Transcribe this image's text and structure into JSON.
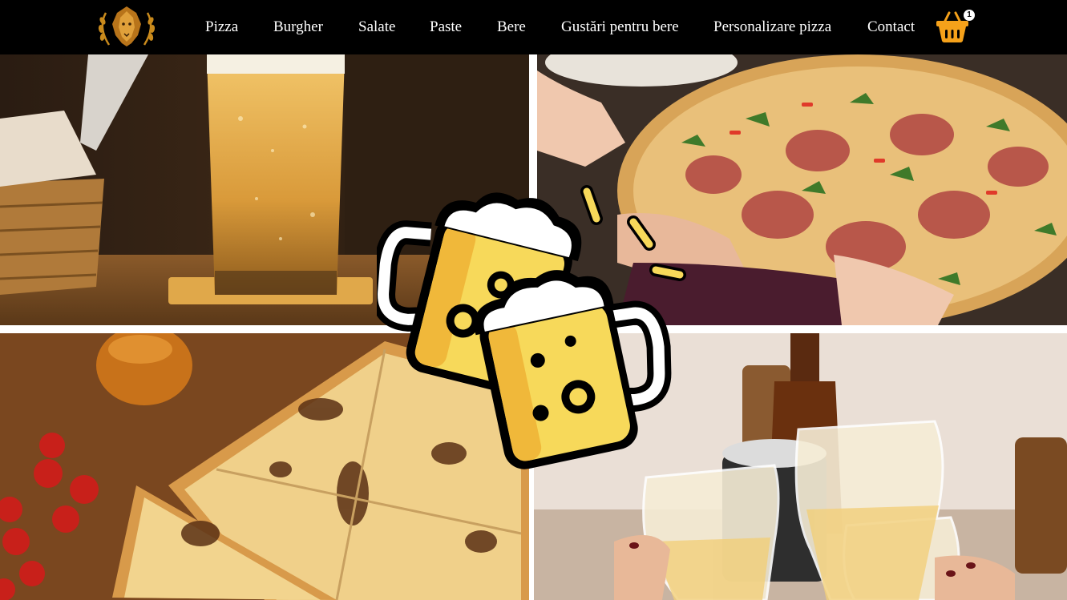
{
  "nav": {
    "logo_icon": "lion-head-laurel-logo",
    "items": [
      {
        "label": "Pizza"
      },
      {
        "label": "Burgher"
      },
      {
        "label": "Salate"
      },
      {
        "label": "Paste"
      },
      {
        "label": "Bere"
      },
      {
        "label": "Gustări pentru bere"
      },
      {
        "label": "Personalizare pizza"
      },
      {
        "label": "Contact"
      }
    ],
    "cart": {
      "icon": "shopping-basket-icon",
      "count": "1",
      "color": "#f5a11a"
    }
  },
  "hero": {
    "tiles": [
      {
        "icon": "beer-glass-photo"
      },
      {
        "icon": "salami-arugula-pizza-photo"
      },
      {
        "icon": "cheese-pizza-photo"
      },
      {
        "icon": "friends-toasting-beer-photo"
      }
    ],
    "center_icon": "cheers-beer-mugs-icon"
  },
  "colors": {
    "navbar": "#000000",
    "accent": "#f5a11a",
    "beer_yellow": "#f7d95a"
  }
}
